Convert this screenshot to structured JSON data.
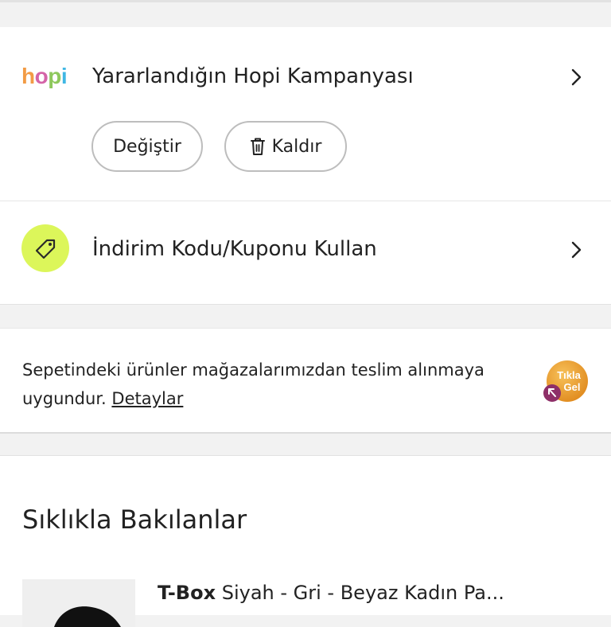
{
  "hopi": {
    "logo_text": "hopi",
    "title": "Yararlandığın Hopi Kampanyası",
    "change_label": "Değiştir",
    "remove_label": "Kaldır"
  },
  "coupon": {
    "title": "İndirim Kodu/Kuponu Kullan"
  },
  "store_pickup": {
    "text": "Sepetindeki ürünler mağazalarımızdan teslim alınmaya uygundur.",
    "link_label": "Detaylar",
    "badge_line1": "Tıkla",
    "badge_line2": "Gel"
  },
  "frequently_viewed": {
    "title": "Sıklıkla Bakılanlar",
    "products": [
      {
        "brand": "T-Box",
        "name": "Siyah - Gri - Beyaz Kadın Pa..."
      }
    ]
  },
  "colors": {
    "accent_lime": "#dcf65a",
    "badge_orange": "#e8a030",
    "badge_purple": "#8e2f68"
  }
}
